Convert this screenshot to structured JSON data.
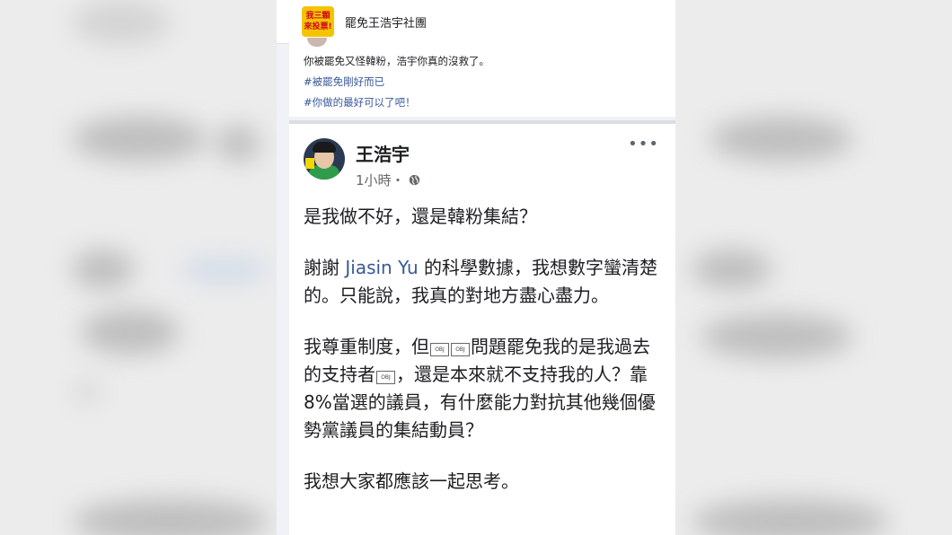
{
  "group": {
    "logo_line1": "我三顆",
    "logo_line2": "來投票!",
    "name": "罷免王浩宇社團"
  },
  "previous_post": {
    "text": "你被罷免又怪韓粉，浩宇你真的沒救了。",
    "tag1": "#被罷免剛好而已",
    "tag2": "#你做的最好可以了吧！"
  },
  "post": {
    "author": "王浩宇",
    "time": "1小時・",
    "more_icon": "more-icon",
    "paragraph1": "是我做不好，還是韓粉集結？",
    "p2_before": "謝謝 ",
    "p2_mention": "Jiasin Yu",
    "p2_after": " 的科學數據，我想數字蠻清楚的。只能說，我真的對地方盡心盡力。",
    "p3_a": "我尊重制度，但",
    "obj_label": "OBJ",
    "p3_b": "問題罷免我的是我過去的支持者",
    "p3_c": "，還是本來就不支持我的人？靠8%當選的議員，有什麼能力對抗其他幾個優勢黨議員的集結動員？",
    "paragraph4": "我想大家都應該一起思考。"
  },
  "colors": {
    "link": "#385898",
    "text": "#1c1e21",
    "meta": "#65676b"
  }
}
